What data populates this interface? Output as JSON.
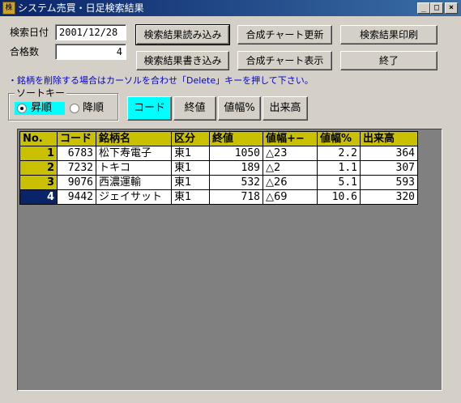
{
  "window": {
    "title": "システム売買・日足検索結果",
    "app_icon_text": "株"
  },
  "search": {
    "date_label": "検索日付",
    "date_value": "2001/12/28",
    "pass_label": "合格数",
    "pass_value": "4"
  },
  "buttons": {
    "load": "検索結果読み込み",
    "save": "検索結果書き込み",
    "chart_update": "合成チャート更新",
    "chart_show": "合成チャート表示",
    "print": "検索結果印刷",
    "exit": "終了"
  },
  "hint": "・銘柄を削除する場合はカーソルを合わせ「Delete」キーを押して下さい。",
  "sort": {
    "title": "ソートキー",
    "asc": "昇順",
    "desc": "降順",
    "selected_order": "昇順",
    "keys": [
      "コード",
      "終値",
      "値幅%",
      "出来高"
    ],
    "active_key": "コード"
  },
  "table": {
    "headers": [
      "No.",
      "コード",
      "銘柄名",
      "区分",
      "終値",
      "値幅+−",
      "値幅%",
      "出来高"
    ],
    "rows": [
      [
        "1",
        "6783",
        "松下寿電子",
        "東1",
        "1050",
        "△23",
        "2.2",
        "364"
      ],
      [
        "2",
        "7232",
        "トキコ",
        "東1",
        "189",
        "△2",
        "1.1",
        "307"
      ],
      [
        "3",
        "9076",
        "西濃運輸",
        "東1",
        "532",
        "△26",
        "5.1",
        "593"
      ],
      [
        "4",
        "9442",
        "ジェイサット",
        "東1",
        "718",
        "△69",
        "10.6",
        "320"
      ]
    ],
    "selected_row": "4"
  }
}
